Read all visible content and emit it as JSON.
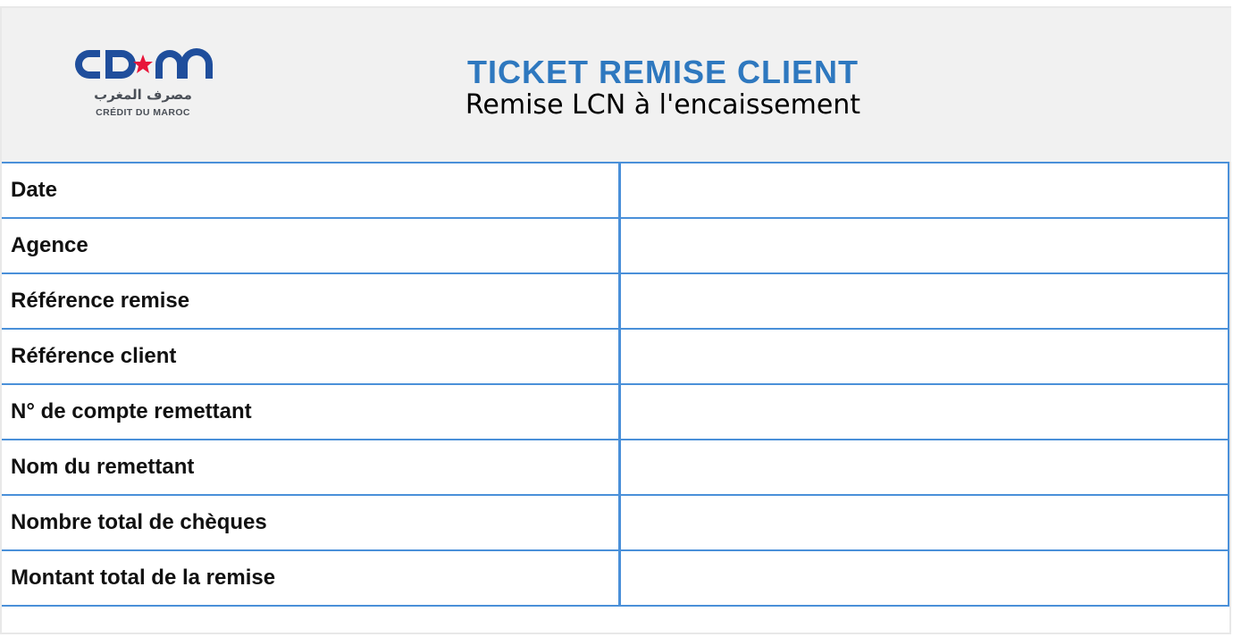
{
  "logo": {
    "mark": "CDM",
    "arabic": "مصرف المغرب",
    "latin": "CRÉDIT DU MAROC",
    "colors": {
      "brand": "#1f4e9c",
      "star": "#e8163a"
    }
  },
  "title": "TICKET REMISE CLIENT",
  "subtitle": "Remise LCN à l'encaissement",
  "colors": {
    "accent": "#2e78bf",
    "grid": "#4a90d9",
    "header_bg": "#f1f1f1"
  },
  "fields": [
    {
      "label": "Date",
      "value": ""
    },
    {
      "label": "Agence",
      "value": ""
    },
    {
      "label": "Référence remise",
      "value": ""
    },
    {
      "label": "Référence client",
      "value": ""
    },
    {
      "label": "N°  de compte remettant",
      "value": ""
    },
    {
      "label": "Nom du remettant",
      "value": ""
    },
    {
      "label": "Nombre total de chèques",
      "value": ""
    },
    {
      "label": "Montant total de la remise",
      "value": ""
    }
  ]
}
